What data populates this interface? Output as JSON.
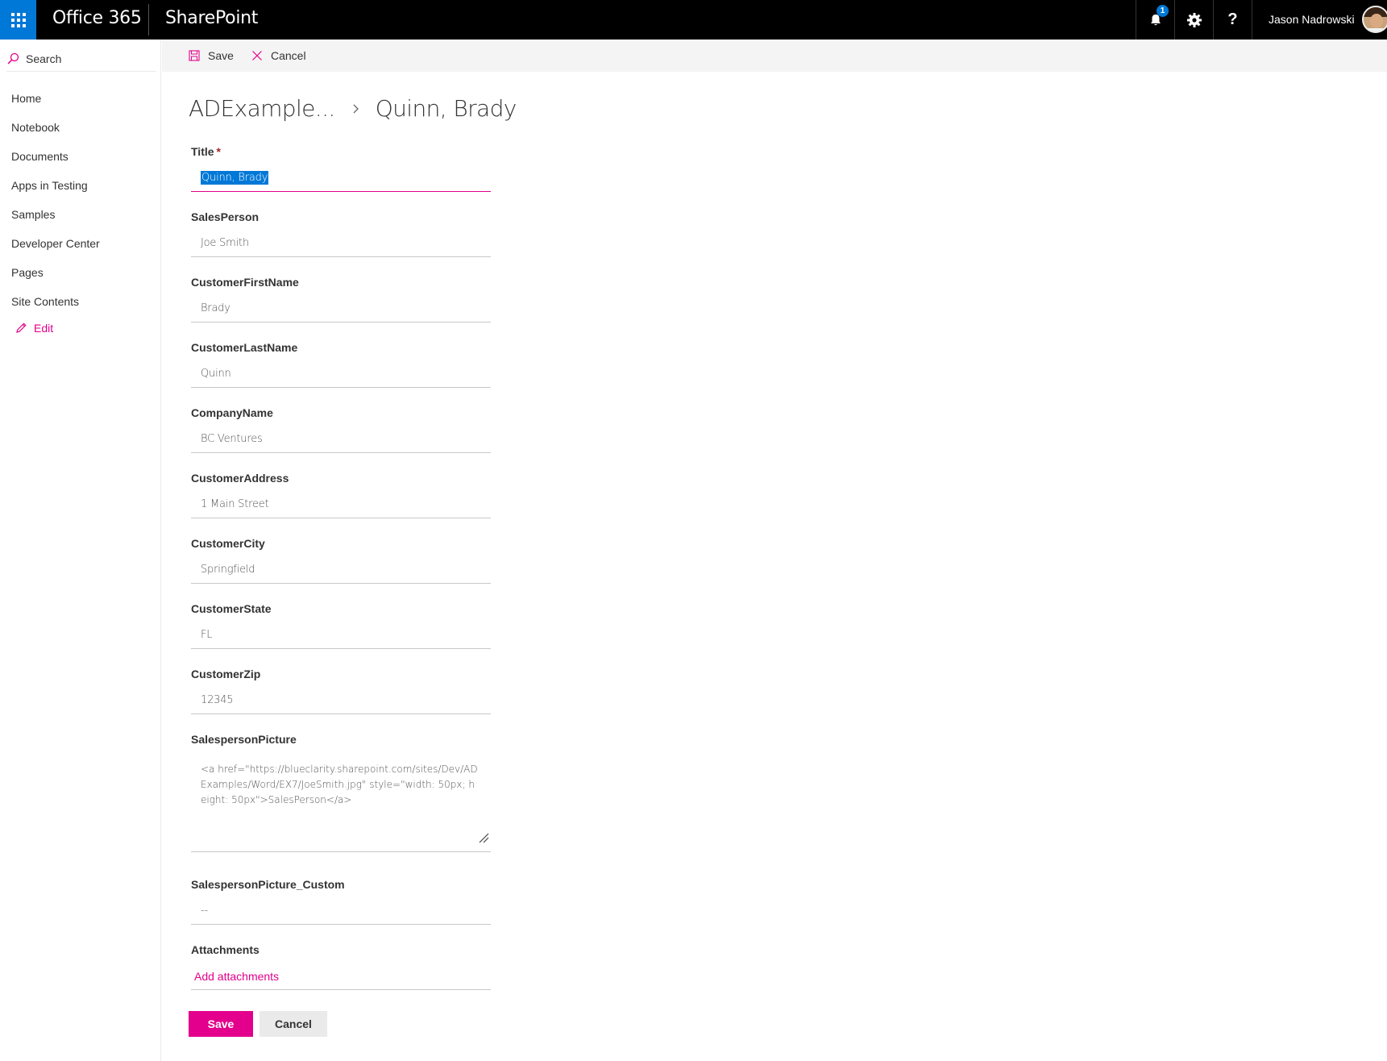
{
  "suite_bar": {
    "brand": "Office 365",
    "app": "SharePoint",
    "notification_count": "1",
    "help_glyph": "?",
    "user_name": "Jason Nadrowski",
    "accent_color": "#0078d7"
  },
  "left_nav": {
    "search_label": "Search",
    "items": [
      {
        "label": "Home"
      },
      {
        "label": "Notebook"
      },
      {
        "label": "Documents"
      },
      {
        "label": "Apps in Testing"
      },
      {
        "label": "Samples"
      },
      {
        "label": "Developer Center"
      },
      {
        "label": "Pages"
      },
      {
        "label": "Site Contents"
      }
    ],
    "edit_label": "Edit"
  },
  "command_bar": {
    "save_label": "Save",
    "cancel_label": "Cancel"
  },
  "breadcrumb": {
    "parent": "ADExample...",
    "current": "Quinn, Brady"
  },
  "form": {
    "title": {
      "label": "Title",
      "required_mark": "*",
      "value": "Quinn, Brady"
    },
    "salesperson": {
      "label": "SalesPerson",
      "value": "Joe Smith"
    },
    "first_name": {
      "label": "CustomerFirstName",
      "value": "Brady"
    },
    "last_name": {
      "label": "CustomerLastName",
      "value": "Quinn"
    },
    "company": {
      "label": "CompanyName",
      "value": "BC Ventures"
    },
    "address": {
      "label": "CustomerAddress",
      "value": "1 Main Street"
    },
    "city": {
      "label": "CustomerCity",
      "value": "Springfield"
    },
    "state": {
      "label": "CustomerState",
      "value": "FL"
    },
    "zip": {
      "label": "CustomerZip",
      "value": "12345"
    },
    "picture": {
      "label": "SalespersonPicture",
      "value": "<a href=\"https://blueclarity.sharepoint.com/sites/Dev/ADExamples/Word/EX7/JoeSmith.jpg\" style=\"width: 50px; height: 50px\">SalesPerson</a>"
    },
    "picture_custom": {
      "label": "SalespersonPicture_Custom",
      "value": "--"
    },
    "attachments": {
      "label": "Attachments",
      "link": "Add attachments"
    }
  },
  "buttons": {
    "save": "Save",
    "cancel": "Cancel"
  },
  "colors": {
    "theme_accent": "#e3008c",
    "suite_bar": "#000000",
    "waffle": "#0078d7"
  },
  "icons": {
    "waffle": "app-launcher-icon",
    "bell": "bell-icon",
    "gear": "gear-icon",
    "help": "help-icon",
    "search": "search-icon",
    "edit": "pencil-icon",
    "save": "floppy-disk-icon",
    "cancel": "close-icon",
    "breadcrumb_sep": "chevron-right-icon"
  }
}
